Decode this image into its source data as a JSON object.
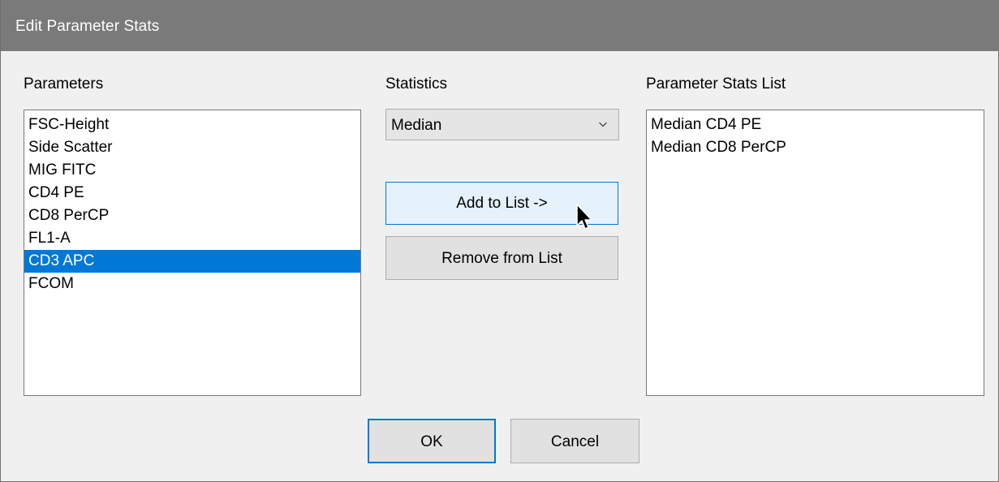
{
  "window": {
    "title": "Edit Parameter Stats"
  },
  "parameters": {
    "label": "Parameters",
    "items": [
      "FSC-Height",
      "Side Scatter",
      "MIG FITC",
      "CD4 PE",
      "CD8 PerCP",
      "FL1-A",
      "CD3 APC",
      "FCOM"
    ],
    "selected": "CD3 APC"
  },
  "statistics": {
    "label": "Statistics",
    "selected": "Median",
    "icon": "chevron-down-icon"
  },
  "stats_list": {
    "label": "Parameter Stats List",
    "items": [
      "Median CD4 PE",
      "Median CD8 PerCP"
    ]
  },
  "buttons": {
    "add": "Add to List ->",
    "remove": "Remove from List",
    "ok": "OK",
    "cancel": "Cancel"
  },
  "colors": {
    "titlebar": "#7a7a7a",
    "selection": "#0078d7",
    "accent": "#0078d7"
  }
}
